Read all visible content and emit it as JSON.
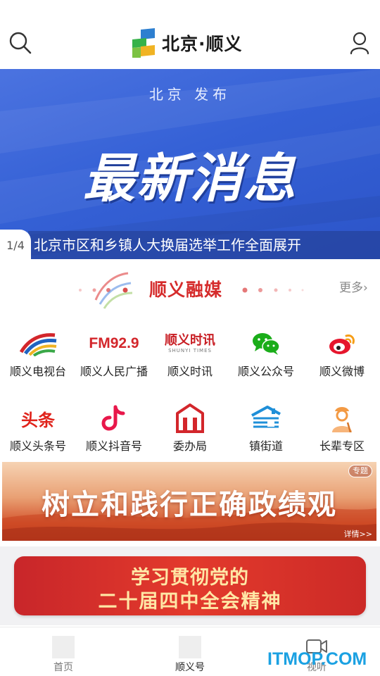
{
  "header": {
    "brand_text": "北京·顺义",
    "search_icon": "search-icon",
    "user_icon": "user-icon"
  },
  "banner": {
    "publisher": "北京 发布",
    "headline": "最新消息",
    "caption": "北京市区和乡镇人大换届选举工作全面展开",
    "index": "1/4"
  },
  "section": {
    "title": "顺义融媒",
    "more": "更多›"
  },
  "grid": {
    "row1": [
      {
        "label": "顺义电视台",
        "icon": "tv-station-icon"
      },
      {
        "label": "顺义人民广播",
        "icon": "fm-radio-icon",
        "icon_text": "FM92.9"
      },
      {
        "label": "顺义时讯",
        "icon": "shunyi-times-icon",
        "icon_text": "顺义时讯",
        "icon_sub": "SHUNYI TIMES"
      },
      {
        "label": "顺义公众号",
        "icon": "wechat-icon"
      },
      {
        "label": "顺义微博",
        "icon": "weibo-icon"
      }
    ],
    "row2": [
      {
        "label": "顺义头条号",
        "icon": "toutiao-icon",
        "icon_text": "头条"
      },
      {
        "label": "顺义抖音号",
        "icon": "douyin-icon"
      },
      {
        "label": "委办局",
        "icon": "government-building-icon"
      },
      {
        "label": "镇街道",
        "icon": "town-street-icon"
      },
      {
        "label": "长辈专区",
        "icon": "elder-zone-icon"
      }
    ]
  },
  "special": {
    "title": "树立和践行正确政绩观",
    "tag": "专题",
    "detail": "详情>>"
  },
  "study": {
    "line1": "学习贯彻党的",
    "line2": "二十届四中全会精神"
  },
  "tabbar": {
    "tabs": [
      {
        "label": "首页"
      },
      {
        "label": "顺义号"
      },
      {
        "label": "视听"
      }
    ]
  },
  "watermark": "ITMOP.COM",
  "colors": {
    "brand_red": "#d52b2b",
    "banner_blue": "#3561d6",
    "watermark_blue": "#1ba1e2"
  }
}
